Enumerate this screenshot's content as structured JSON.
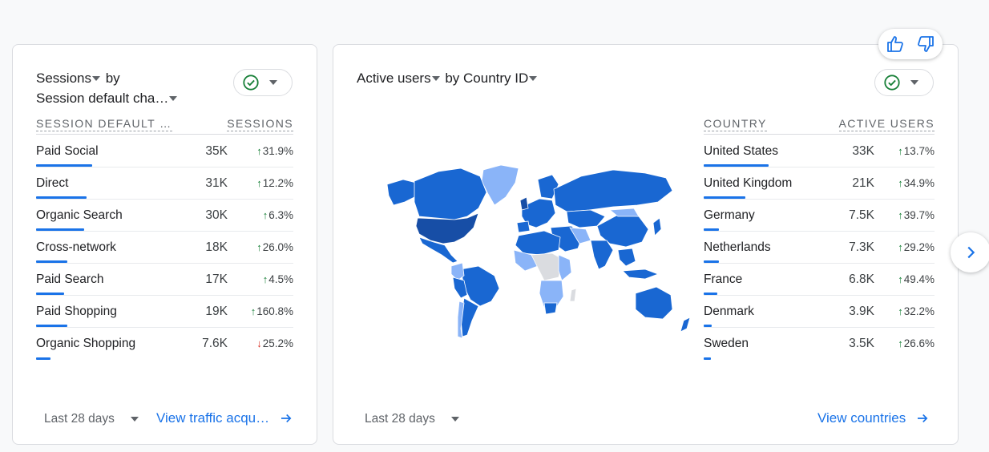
{
  "sessions_card": {
    "title_metric": "Sessions",
    "title_by": "by",
    "title_dimension": "Session default cha…",
    "col_dimension": "SESSION DEFAULT …",
    "col_metric": "SESSIONS",
    "rows": [
      {
        "label": "Paid Social",
        "value": "35K",
        "change": "31.9%",
        "direction": "up",
        "bar": 0.2
      },
      {
        "label": "Direct",
        "value": "31K",
        "change": "12.2%",
        "direction": "up",
        "bar": 0.18
      },
      {
        "label": "Organic Search",
        "value": "30K",
        "change": "6.3%",
        "direction": "up",
        "bar": 0.17
      },
      {
        "label": "Cross-network",
        "value": "18K",
        "change": "26.0%",
        "direction": "up",
        "bar": 0.11
      },
      {
        "label": "Paid Search",
        "value": "17K",
        "change": "4.5%",
        "direction": "up",
        "bar": 0.1
      },
      {
        "label": "Paid Shopping",
        "value": "19K",
        "change": "160.8%",
        "direction": "up",
        "bar": 0.11
      },
      {
        "label": "Organic Shopping",
        "value": "7.6K",
        "change": "25.2%",
        "direction": "down",
        "bar": 0.05
      }
    ],
    "date_range": "Last 28 days",
    "link": "View traffic acqu…"
  },
  "users_card": {
    "title_metric": "Active users",
    "title_by": "by Country ID",
    "col_dimension": "COUNTRY",
    "col_metric": "ACTIVE USERS",
    "rows": [
      {
        "label": "United States",
        "value": "33K",
        "change": "13.7%",
        "direction": "up",
        "bar": 0.28
      },
      {
        "label": "United Kingdom",
        "value": "21K",
        "change": "34.9%",
        "direction": "up",
        "bar": 0.18
      },
      {
        "label": "Germany",
        "value": "7.5K",
        "change": "39.7%",
        "direction": "up",
        "bar": 0.065
      },
      {
        "label": "Netherlands",
        "value": "7.3K",
        "change": "29.2%",
        "direction": "up",
        "bar": 0.064
      },
      {
        "label": "France",
        "value": "6.8K",
        "change": "49.4%",
        "direction": "up",
        "bar": 0.06
      },
      {
        "label": "Denmark",
        "value": "3.9K",
        "change": "32.2%",
        "direction": "up",
        "bar": 0.035
      },
      {
        "label": "Sweden",
        "value": "3.5K",
        "change": "26.6%",
        "direction": "up",
        "bar": 0.03
      }
    ],
    "date_range": "Last 28 days",
    "link": "View countries"
  },
  "colors": {
    "accent": "#1a73e8",
    "up": "#188038",
    "down": "#d93025",
    "map_dark": "#174ea6",
    "map_mid": "#1967d2",
    "map_light": "#8ab4f8",
    "map_none": "#dadce0"
  },
  "icons": {
    "compare": "check-circle-icon",
    "feedback_positive": "thumb-up-icon",
    "feedback_negative": "thumb-down-icon",
    "next": "chevron-right-icon",
    "link_arrow": "arrow-right-icon"
  }
}
